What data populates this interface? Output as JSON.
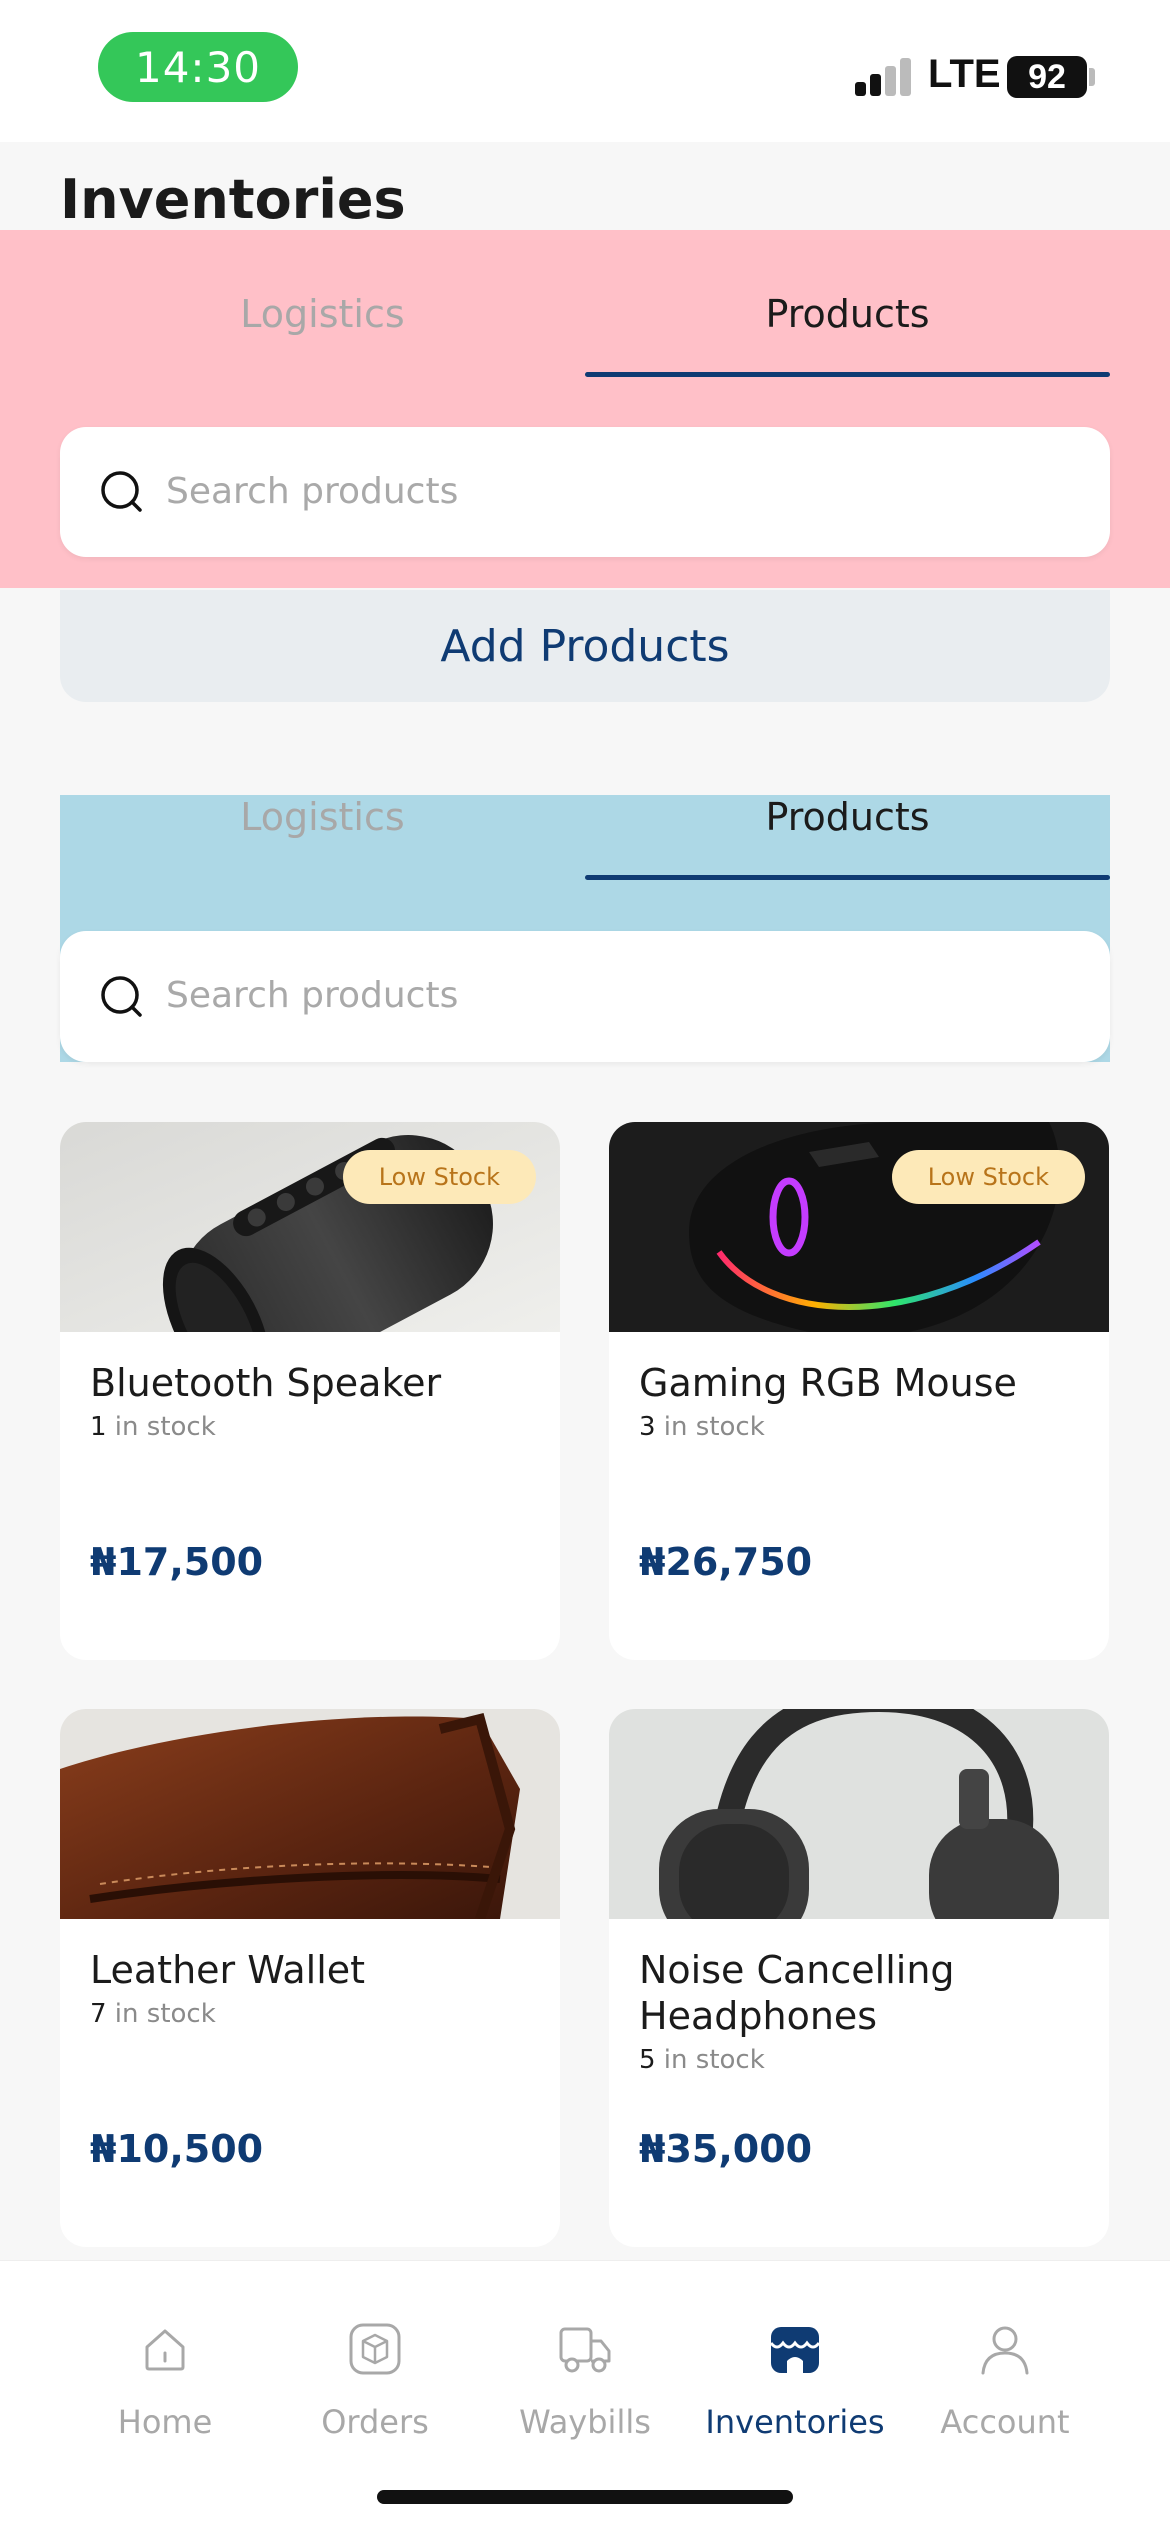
{
  "status_bar": {
    "time": "14:30",
    "network": "LTE",
    "battery": "92"
  },
  "page": {
    "title": "Inventories"
  },
  "tabs": [
    {
      "label": "Logistics",
      "active": false
    },
    {
      "label": "Products",
      "active": true
    }
  ],
  "search": {
    "placeholder": "Search products"
  },
  "add_products_label": "Add Products",
  "products": [
    {
      "name": "Bluetooth Speaker",
      "stock_count": "1",
      "stock_suffix": " in stock",
      "price": "₦17,500",
      "badge": "Low Stock",
      "image": "speaker-image"
    },
    {
      "name": "Gaming RGB Mouse",
      "stock_count": "3",
      "stock_suffix": " in stock",
      "price": "₦26,750",
      "badge": "Low Stock",
      "image": "mouse-image"
    },
    {
      "name": "Leather Wallet",
      "stock_count": "7",
      "stock_suffix": " in stock",
      "price": "₦10,500",
      "badge": "",
      "image": "wallet-image"
    },
    {
      "name": "Noise Cancelling Headphones",
      "stock_count": "5",
      "stock_suffix": " in stock",
      "price": "₦35,000",
      "badge": "",
      "image": "headphones-image"
    }
  ],
  "bottom_nav": [
    {
      "label": "Home",
      "icon": "home-icon",
      "active": false
    },
    {
      "label": "Orders",
      "icon": "box-icon",
      "active": false
    },
    {
      "label": "Waybills",
      "icon": "truck-icon",
      "active": false
    },
    {
      "label": "Inventories",
      "icon": "store-icon",
      "active": true
    },
    {
      "label": "Account",
      "icon": "user-icon",
      "active": false
    }
  ],
  "colors": {
    "accent": "#0f3b73",
    "status_pill": "#34c759",
    "overlay_pink": "#ffc0c8",
    "overlay_blue": "#add8e6",
    "badge_bg": "#fde9b8",
    "badge_text": "#b8741a"
  }
}
